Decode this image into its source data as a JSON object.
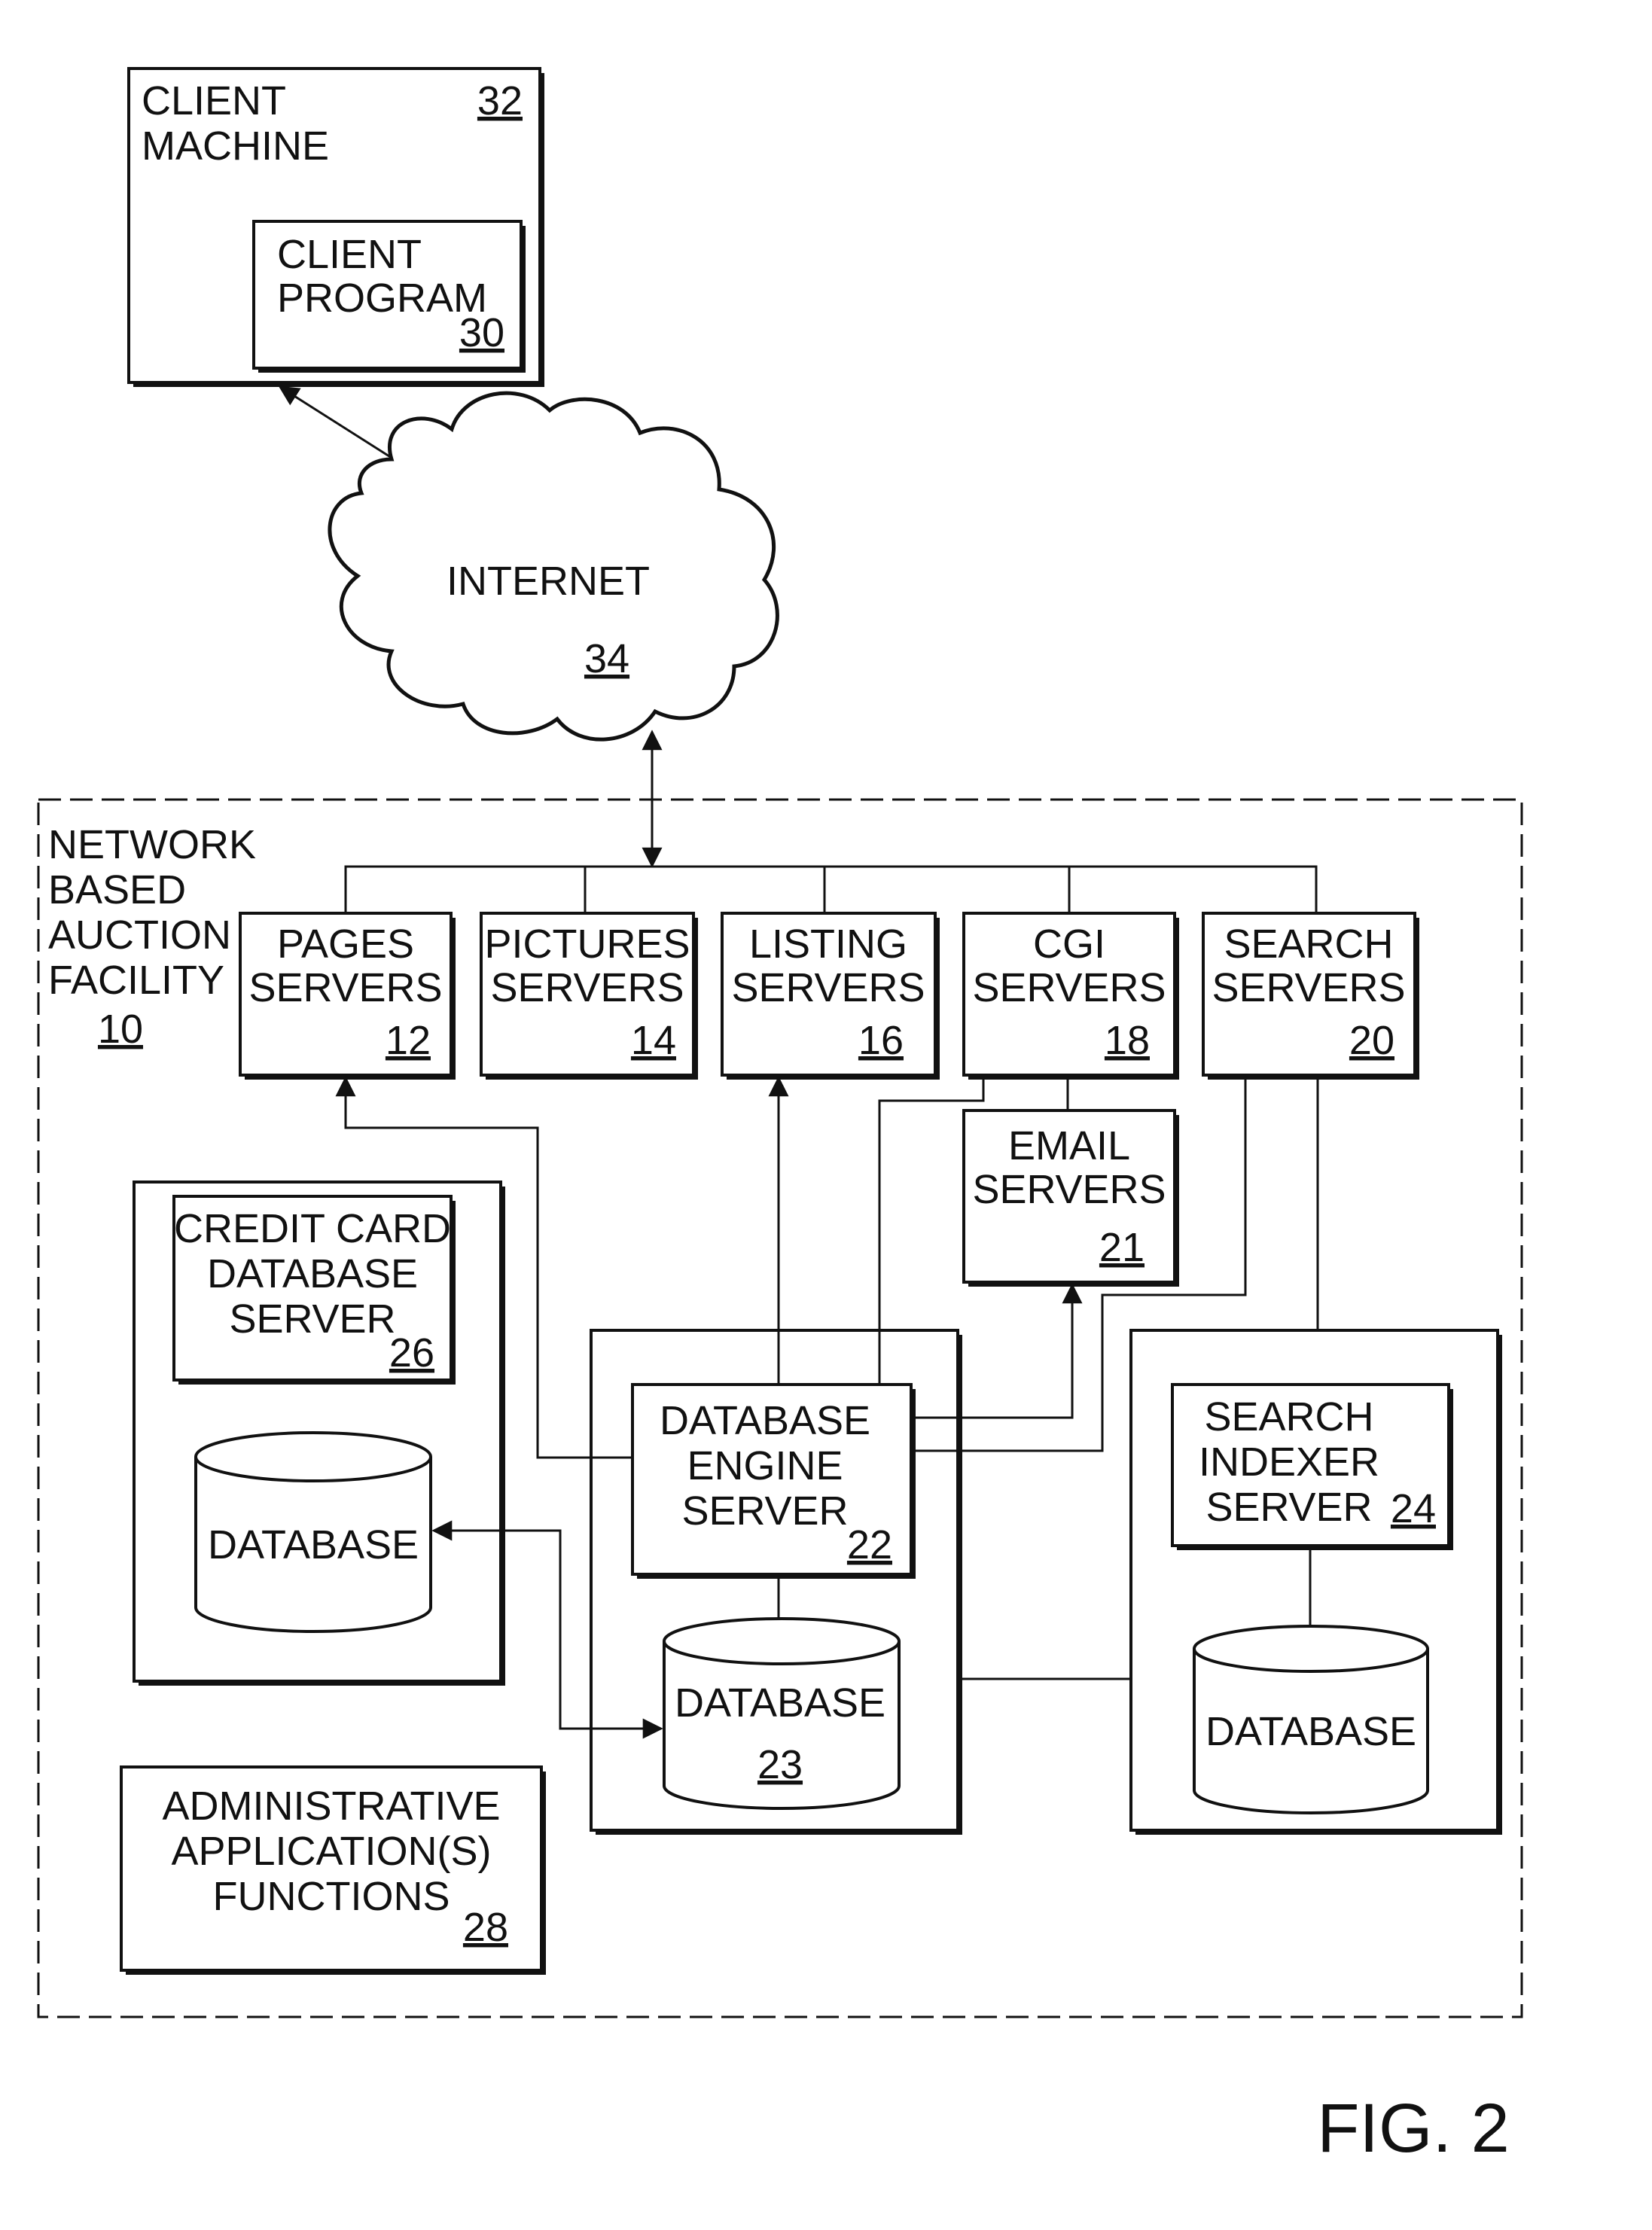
{
  "figure_label": "FIG. 2",
  "client_machine": {
    "label": [
      "CLIENT",
      "MACHINE"
    ],
    "ref": "32"
  },
  "client_program": {
    "label": [
      "CLIENT",
      "PROGRAM"
    ],
    "ref": "30"
  },
  "internet": {
    "label": "INTERNET",
    "ref": "34"
  },
  "facility": {
    "label": [
      "NETWORK",
      "BASED",
      "AUCTION",
      "FACILITY"
    ],
    "ref": "10"
  },
  "servers": [
    {
      "id": "pages",
      "label": [
        "PAGES",
        "SERVERS"
      ],
      "ref": "12"
    },
    {
      "id": "pictures",
      "label": [
        "PICTURES",
        "SERVERS"
      ],
      "ref": "14"
    },
    {
      "id": "listing",
      "label": [
        "LISTING",
        "SERVERS"
      ],
      "ref": "16"
    },
    {
      "id": "cgi",
      "label": [
        "CGI",
        "SERVERS"
      ],
      "ref": "18"
    },
    {
      "id": "search",
      "label": [
        "SEARCH",
        "SERVERS"
      ],
      "ref": "20"
    }
  ],
  "email_servers": {
    "label": [
      "EMAIL",
      "SERVERS"
    ],
    "ref": "21"
  },
  "credit_card_server": {
    "label": [
      "CREDIT CARD",
      "DATABASE",
      "SERVER"
    ],
    "ref": "26"
  },
  "credit_card_database": {
    "label": "DATABASE"
  },
  "database_engine_server": {
    "label": [
      "DATABASE",
      "ENGINE",
      "SERVER"
    ],
    "ref": "22"
  },
  "database_23": {
    "label": "DATABASE",
    "ref": "23"
  },
  "search_indexer_server": {
    "label": [
      "SEARCH",
      "INDEXER",
      "SERVER"
    ],
    "ref": "24"
  },
  "search_database": {
    "label": "DATABASE"
  },
  "admin_functions": {
    "label": [
      "ADMINISTRATIVE",
      "APPLICATION(S)",
      "FUNCTIONS"
    ],
    "ref": "28"
  }
}
